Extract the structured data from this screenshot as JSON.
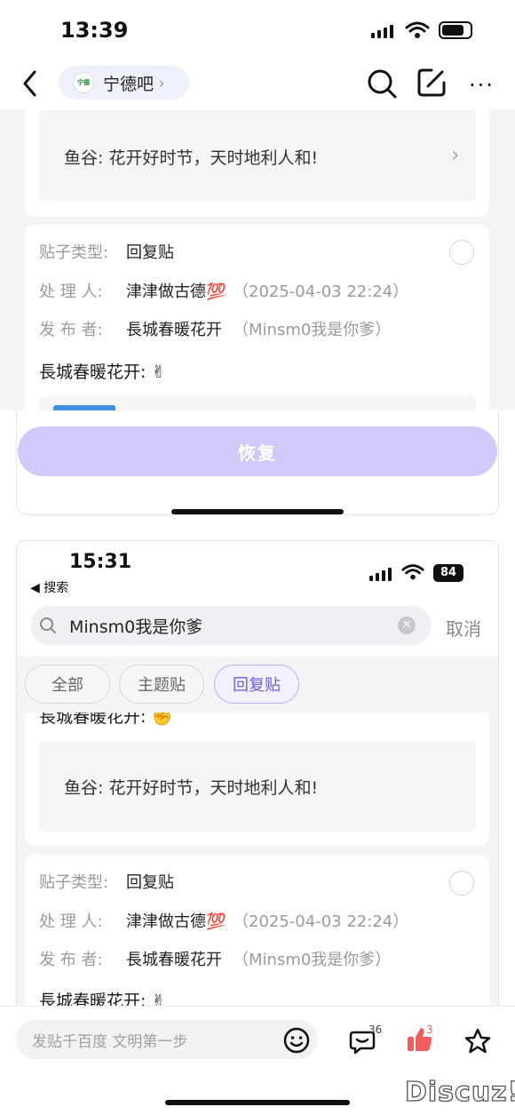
{
  "status_bar": {
    "time": "13:39"
  },
  "nav": {
    "forum_name": "宁德吧",
    "logo_text": "宁德"
  },
  "top_quote": {
    "text": "鱼谷: 花开好时节，天时地利人和!"
  },
  "labels": {
    "post_type": "贴子类型:",
    "handler": "处 理 人:",
    "publisher": "发 布 者:"
  },
  "card1": {
    "post_type": "回复贴",
    "handler_name": "津津做古德💯",
    "handler_time": "（2025-04-03 22:24）",
    "publisher_name": "長城春暖花开",
    "publisher_alias": "（Minsm0我是你爹）",
    "content": "長城春暖花开: ✌"
  },
  "restore_button": {
    "label": "恢复"
  },
  "second": {
    "status_time": "15:31",
    "back_label": "◀ 搜索",
    "battery": "84",
    "search_value": "Minsm0我是你爹",
    "cancel_label": "取消",
    "filters": [
      "全部",
      "主题贴",
      "回复贴"
    ],
    "truncated_content": "長城春暖花开: ✊",
    "quote_text": "鱼谷: 花开好时节，天时地利人和!",
    "card2": {
      "post_type": "回复贴",
      "handler_name": "津津做古德💯",
      "handler_time": "（2025-04-03 22:24）",
      "publisher_name": "長城春暖花开",
      "publisher_alias": "（Minsm0我是你爹）",
      "content": "長城春暖花开: ✌"
    }
  },
  "bottom_bar": {
    "input_placeholder": "发贴千百度 文明第一步",
    "comment_count": "36",
    "like_count": "3"
  },
  "watermark": "Discuz!"
}
